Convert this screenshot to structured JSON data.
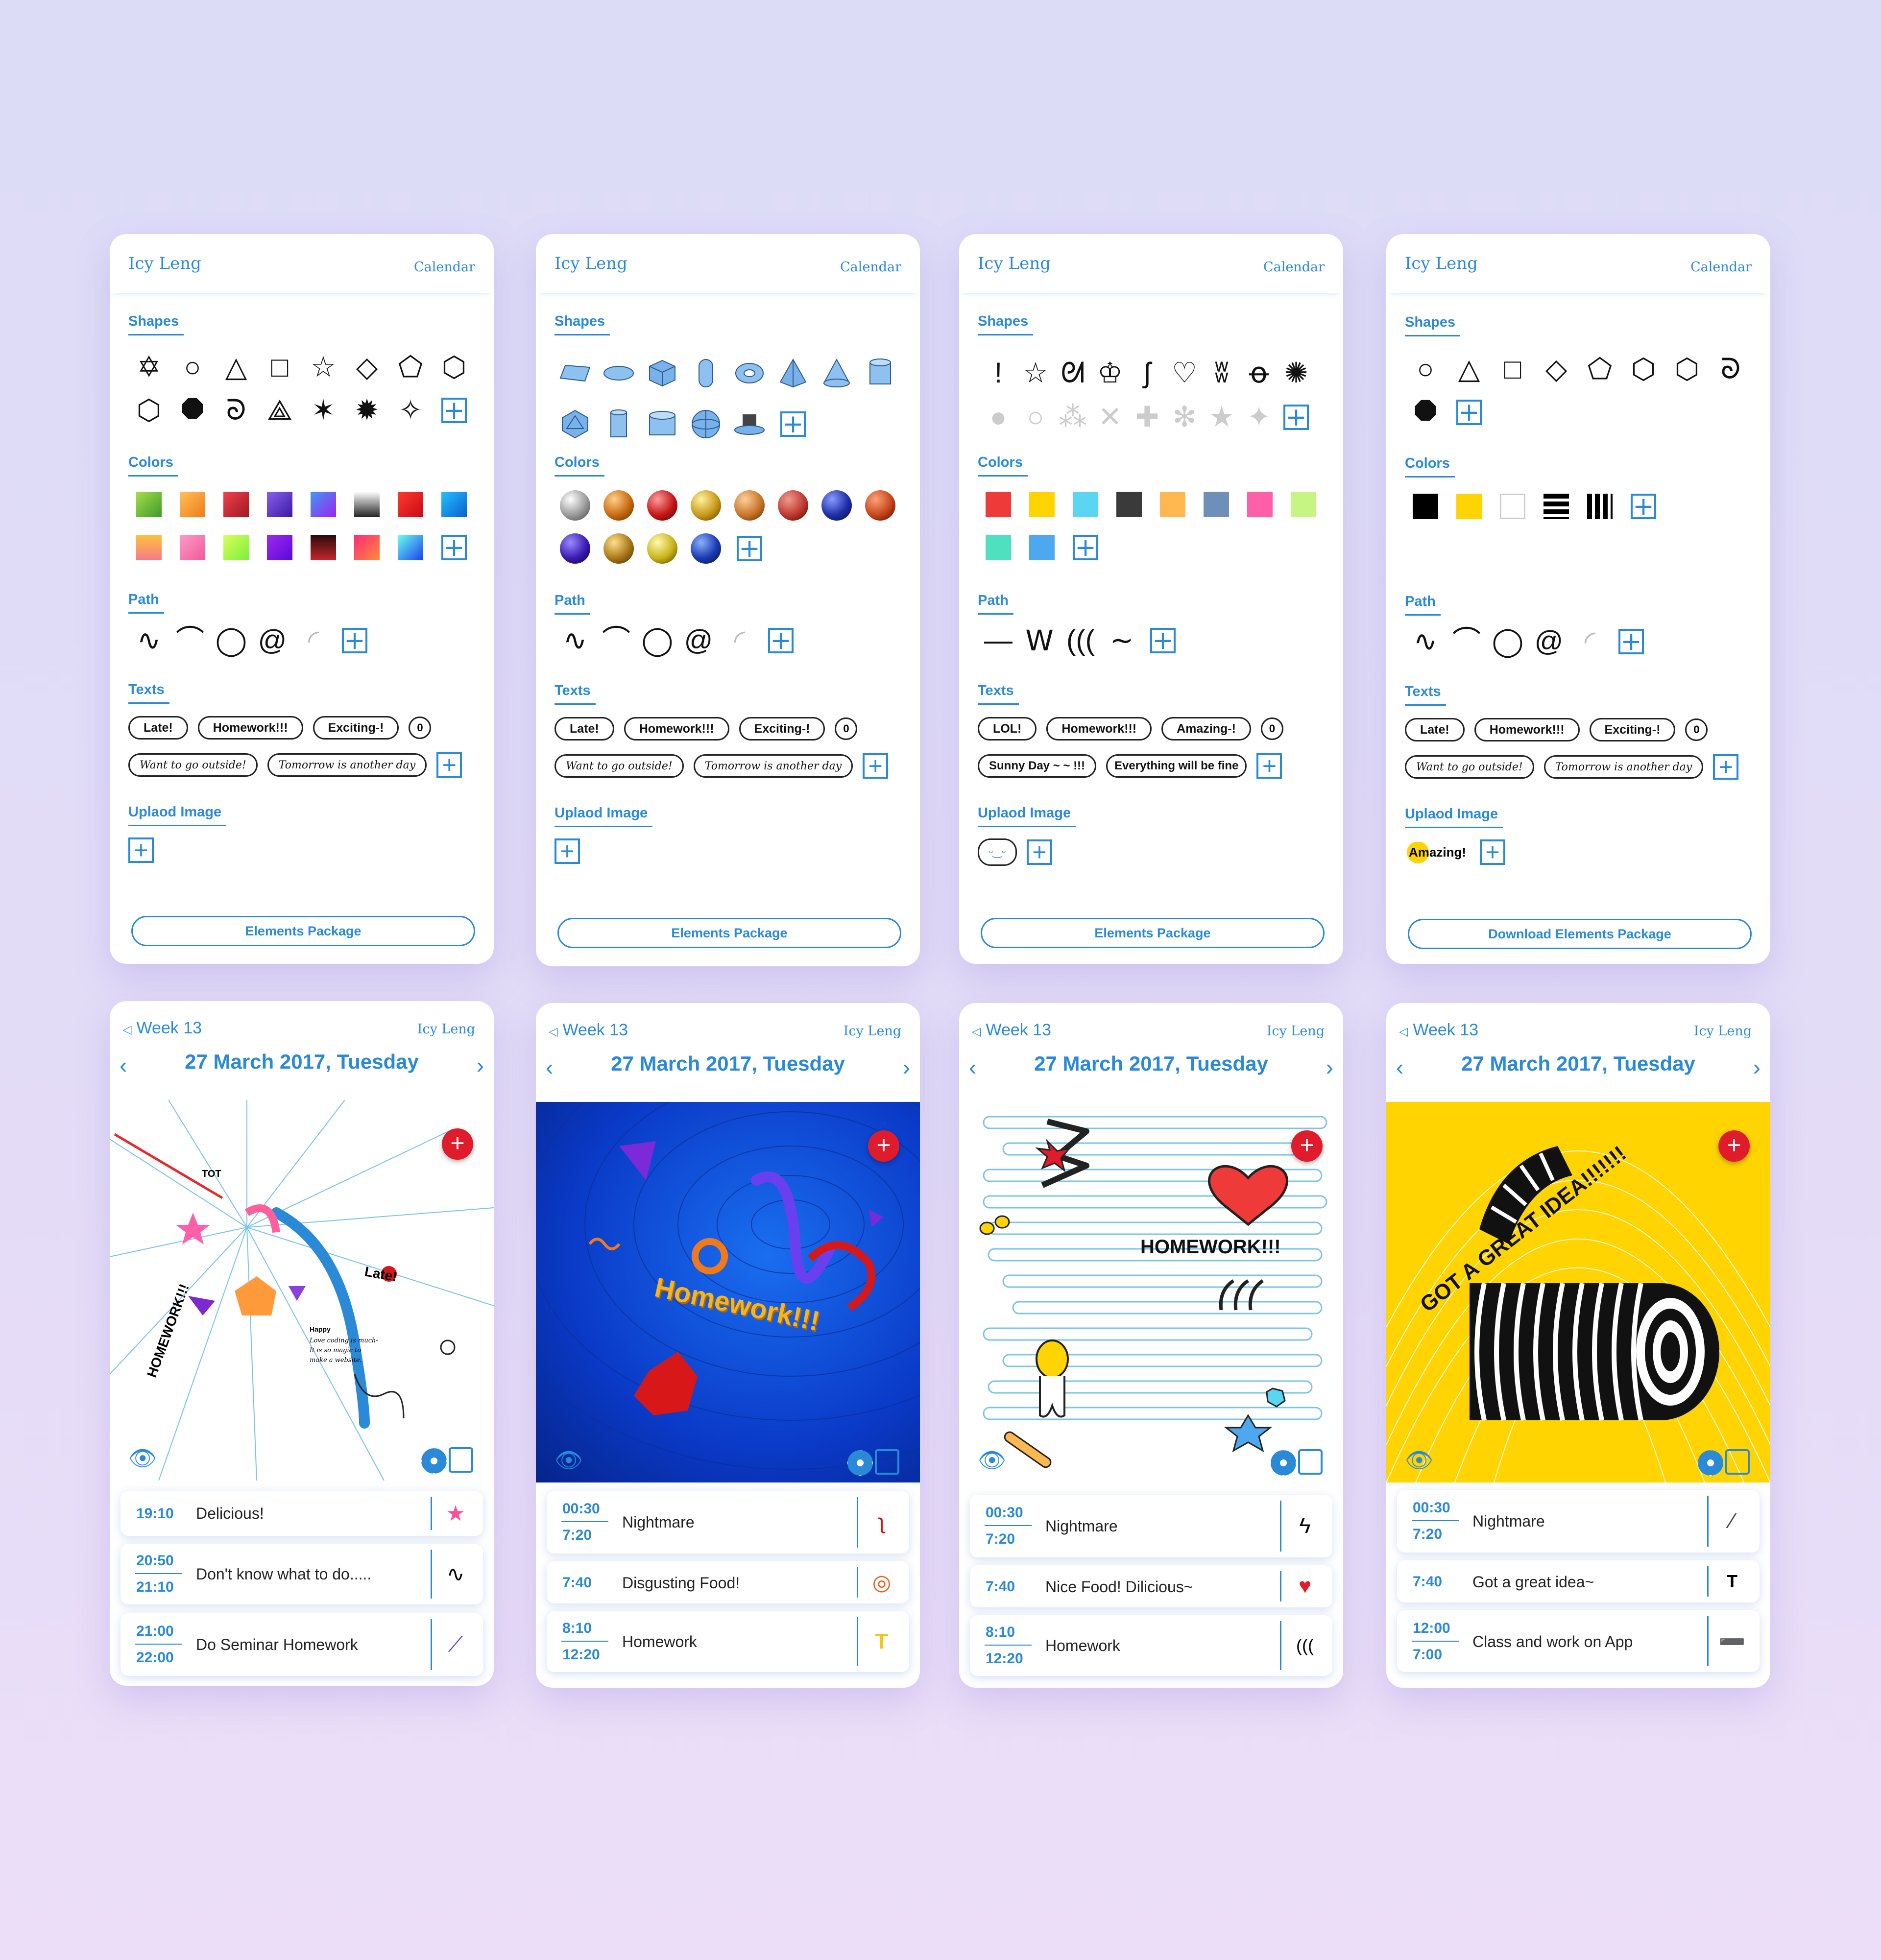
{
  "app": {
    "user": "Icy Leng",
    "calendar_label": "Calendar",
    "week_label": "Week 13",
    "date": "27 March 2017, Tuesday"
  },
  "sections": {
    "shapes": "Shapes",
    "colors": "Colors",
    "path": "Path",
    "texts": "Texts",
    "upload": "Uplaod Image"
  },
  "palettes": [
    {
      "texts": [
        "Late!",
        "Homework!!!",
        "Exciting-!",
        "0",
        "Want to go outside!",
        "Tomorrow is another day"
      ],
      "upload_preview": "",
      "package": "Elements Package",
      "colors": [
        "#6ab83a",
        "#f59a2f",
        "#d62e36",
        "#6a3fd6",
        "#3f7af2",
        "#555555",
        "#e6212b",
        "#1797e6",
        "#f4a030",
        "#ff7bb4",
        "#a8f03b",
        "#7a11e8",
        "#7a1a1a",
        "#f03f93",
        "#28e6f2"
      ]
    },
    {
      "texts": [
        "Late!",
        "Homework!!!",
        "Exciting-!",
        "0",
        "Want to go outside!",
        "Tomorrow is another day"
      ],
      "upload_preview": "",
      "package": "Elements Package",
      "colors": [
        "#9a9a9a",
        "#c96a10",
        "#c41818",
        "#c99a18",
        "#c9762a",
        "#c03a30",
        "#1f2fa8",
        "#c4461a",
        "#3a1ab0",
        "#a8781a",
        "#c9b318",
        "#1a3ab0"
      ]
    },
    {
      "texts": [
        "LOL!",
        "Homework!!!",
        "Amazing-!",
        "0",
        "Sunny Day ~ ~ !!!",
        "Everything will be fine"
      ],
      "upload_preview": "",
      "package": "Elements Package",
      "colors": [
        "#ef3a3a",
        "#ffd400",
        "#5bd6f2",
        "#3a3a3a",
        "#ffb84f",
        "#6e8fb8",
        "#ff5fa8",
        "#c6f584",
        "#4fe0bf",
        "#4da8ef"
      ]
    },
    {
      "texts": [
        "Late!",
        "Homework!!!",
        "Exciting-!",
        "0",
        "Want to go outside!",
        "Tomorrow is another day"
      ],
      "upload_preview": "Amazing!",
      "package": "Download Elements Package",
      "colors": [
        "#000000",
        "#ffd400",
        "#ffffff"
      ]
    }
  ],
  "days": [
    {
      "canvas_labels": [
        "TOT",
        "Late!",
        "HOMEWORK!!!",
        "Happy",
        "Love coding is much- It is so magic to make a website."
      ],
      "events": [
        {
          "start": "19:10",
          "end": "",
          "title": "Delicious!",
          "icon": "star-icon"
        },
        {
          "start": "20:50",
          "end": "21:10",
          "title": "Don't know what to do.....",
          "icon": "squiggle-icon"
        },
        {
          "start": "21:00",
          "end": "22:00",
          "title": "Do Seminar Homework",
          "icon": "ribbon-icon"
        }
      ]
    },
    {
      "canvas_labels": [
        "Homework!!!"
      ],
      "events": [
        {
          "start": "00:30",
          "end": "7:20",
          "title": "Nightmare",
          "icon": "red-squiggle-icon"
        },
        {
          "start": "7:40",
          "end": "",
          "title": "Disgusting Food!",
          "icon": "torus-icon"
        },
        {
          "start": "8:10",
          "end": "12:20",
          "title": "Homework",
          "icon": "t-shape-icon"
        }
      ]
    },
    {
      "canvas_labels": [
        "HOMEWORK!!!"
      ],
      "events": [
        {
          "start": "00:30",
          "end": "7:20",
          "title": "Nightmare",
          "icon": "zigzag-icon"
        },
        {
          "start": "7:40",
          "end": "",
          "title": "Nice Food! Dilicious~",
          "icon": "heart-icon"
        },
        {
          "start": "8:10",
          "end": "12:20",
          "title": "Homework",
          "icon": "waves-icon"
        }
      ]
    },
    {
      "canvas_labels": [
        "GOT A GREAT IDEA!!!!!!!"
      ],
      "events": [
        {
          "start": "00:30",
          "end": "7:20",
          "title": "Nightmare",
          "icon": "brush-icon"
        },
        {
          "start": "7:40",
          "end": "",
          "title": "Got a great idea~",
          "icon": "t-letter-icon"
        },
        {
          "start": "12:00",
          "end": "7:00",
          "title": "Class and work on App",
          "icon": "stroke-icon"
        }
      ]
    }
  ]
}
